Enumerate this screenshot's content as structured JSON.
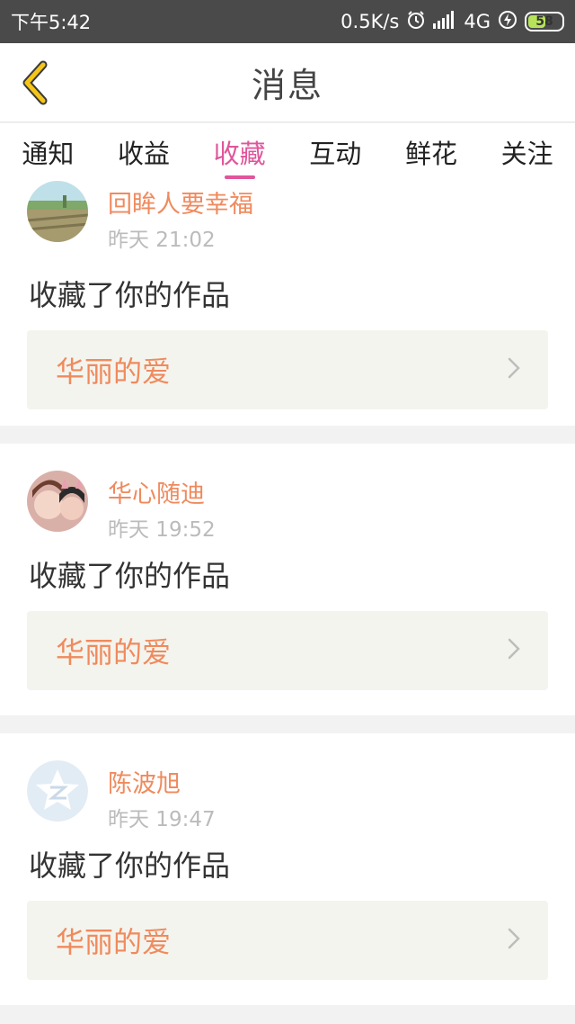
{
  "status_bar": {
    "time": "下午5:42",
    "speed": "0.5K/s",
    "network": "4G",
    "battery": "58",
    "battery_level": 0.58
  },
  "header": {
    "title": "消息"
  },
  "tabs": [
    {
      "label": "通知"
    },
    {
      "label": "收益"
    },
    {
      "label": "收藏",
      "active": true
    },
    {
      "label": "互动"
    },
    {
      "label": "鲜花"
    },
    {
      "label": "关注"
    }
  ],
  "messages": [
    {
      "user": "回眸人要幸福",
      "time": "昨天 21:02",
      "action": "收藏了你的作品",
      "work": "华丽的爱",
      "avatar": "landscape-avatar"
    },
    {
      "user": "华心随迪",
      "time": "昨天 19:52",
      "action": "收藏了你的作品",
      "work": "华丽的爱",
      "avatar": "photo-avatar"
    },
    {
      "user": "陈波旭",
      "time": "昨天 19:47",
      "action": "收藏了你的作品",
      "work": "华丽的爱",
      "avatar": "qq-default-avatar"
    }
  ],
  "colors": {
    "accent": "#e0559b",
    "username": "#f08a5d",
    "back_icon": "#f5c518"
  }
}
